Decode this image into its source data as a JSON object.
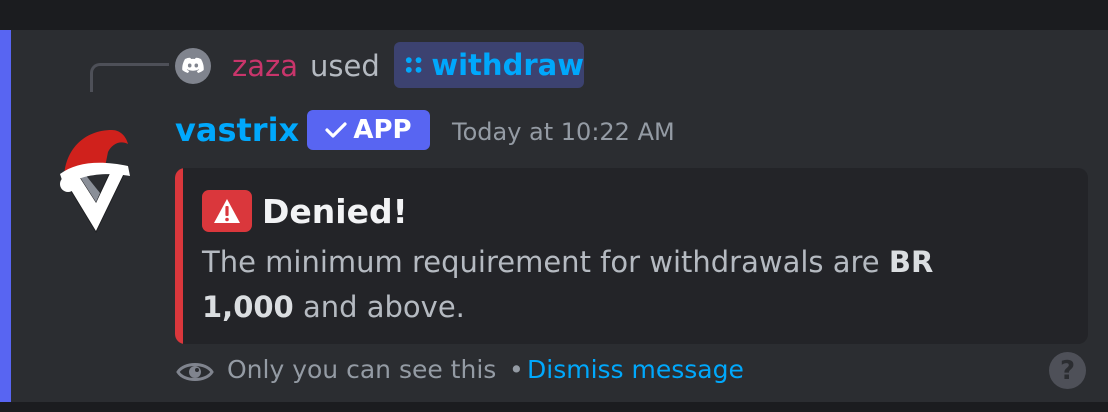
{
  "reply": {
    "username": "zaza",
    "used_text": "used",
    "command": "withdraw"
  },
  "author": {
    "name": "vastrix",
    "badge": "APP",
    "timestamp": "Today at 10:22 AM"
  },
  "embed": {
    "title": "Denied!",
    "description_prefix": "The minimum requirement for withdrawals are ",
    "description_bold": "BR 1,000",
    "description_suffix": " and above.",
    "border_color": "#da373c"
  },
  "footer": {
    "visibility_text": "Only you can see this",
    "separator": "•",
    "dismiss_label": "Dismiss message",
    "help_label": "?"
  },
  "colors": {
    "accent": "#5865f2",
    "link": "#00a8fc",
    "reply_user": "#c9356b"
  },
  "icons": [
    "discord-icon",
    "slash-command-icon",
    "checkmark-icon",
    "warning-icon",
    "eye-icon",
    "help-icon"
  ]
}
